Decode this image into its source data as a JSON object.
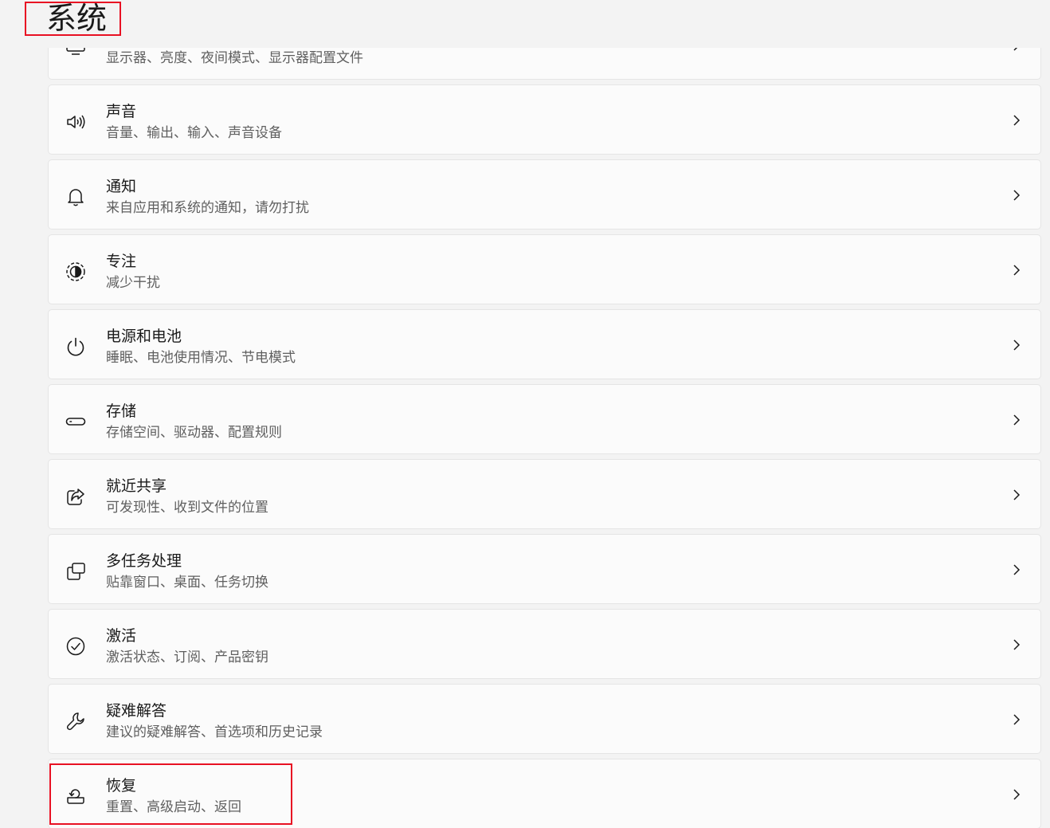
{
  "header": {
    "title": "系统"
  },
  "items": [
    {
      "label": "",
      "description": "显示器、亮度、夜间模式、显示器配置文件",
      "icon": "display-icon"
    },
    {
      "label": "声音",
      "description": "音量、输出、输入、声音设备",
      "icon": "speaker-icon"
    },
    {
      "label": "通知",
      "description": "来自应用和系统的通知，请勿打扰",
      "icon": "bell-icon"
    },
    {
      "label": "专注",
      "description": "减少干扰",
      "icon": "focus-icon"
    },
    {
      "label": "电源和电池",
      "description": "睡眠、电池使用情况、节电模式",
      "icon": "power-icon"
    },
    {
      "label": "存储",
      "description": "存储空间、驱动器、配置规则",
      "icon": "storage-icon"
    },
    {
      "label": "就近共享",
      "description": "可发现性、收到文件的位置",
      "icon": "share-icon"
    },
    {
      "label": "多任务处理",
      "description": "贴靠窗口、桌面、任务切换",
      "icon": "multitask-icon"
    },
    {
      "label": "激活",
      "description": "激活状态、订阅、产品密钥",
      "icon": "check-circle-icon"
    },
    {
      "label": "疑难解答",
      "description": "建议的疑难解答、首选项和历史记录",
      "icon": "wrench-icon"
    },
    {
      "label": "恢复",
      "description": "重置、高级启动、返回",
      "icon": "recovery-icon"
    }
  ],
  "colors": {
    "highlight": "#e81123",
    "page_bg": "#f3f3f3",
    "card_bg": "#fbfbfb"
  }
}
